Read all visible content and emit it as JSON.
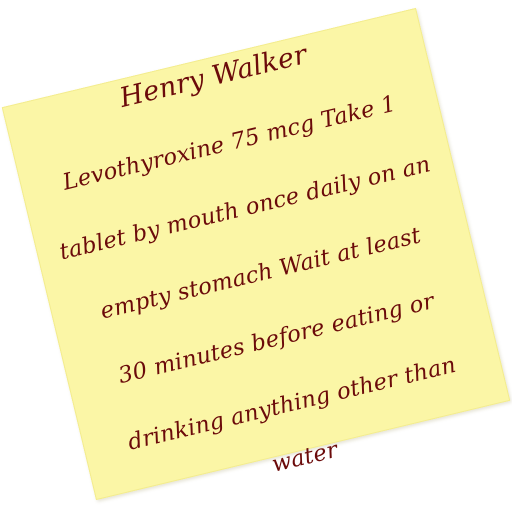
{
  "note": {
    "patient_name": "Henry Walker",
    "lines": [
      "Levothyroxine 75 mcg Take 1",
      "tablet by mouth once daily on an",
      "empty stomach Wait at least",
      "30 minutes before eating or",
      "drinking anything other than",
      "water"
    ],
    "paper_color": "#fbf6a6",
    "ink_color": "#6b0a0a"
  }
}
